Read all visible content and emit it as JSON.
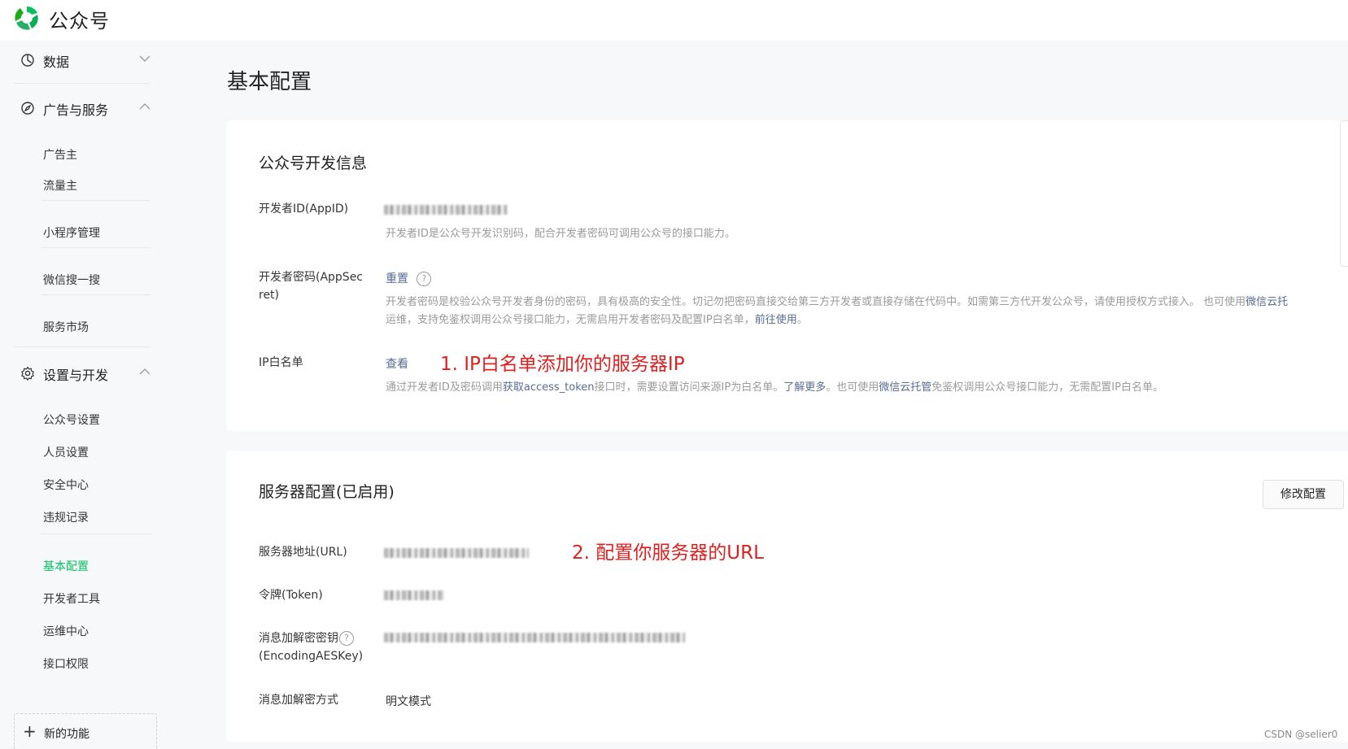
{
  "app": {
    "brand": "公众号"
  },
  "sidebar": {
    "groups": [
      {
        "label": "数据",
        "icon": "pie-chart-icon",
        "expanded": false
      },
      {
        "label": "广告与服务",
        "icon": "compass-icon",
        "expanded": true
      },
      {
        "label": "设置与开发",
        "icon": "gear-icon",
        "expanded": true
      }
    ],
    "items": {
      "ad_owner": "广告主",
      "traffic_owner": "流量主",
      "mini_program": "小程序管理",
      "wechat_search": "微信搜一搜",
      "service_market": "服务市场",
      "account_settings": "公众号设置",
      "staff_settings": "人员设置",
      "security_center": "安全中心",
      "violation_record": "违规记录",
      "basic_config": "基本配置",
      "dev_tools": "开发者工具",
      "ops_center": "运维中心",
      "api_permission": "接口权限"
    },
    "new_feature": "新的功能",
    "active_color": "#07c160"
  },
  "page": {
    "title": "基本配置"
  },
  "dev_info": {
    "title": "公众号开发信息",
    "appid_label": "开发者ID(AppID)",
    "appid_desc": "开发者ID是公众号开发识别码，配合开发者密码可调用公众号的接口能力。",
    "secret_label_1": "开发者密码(AppSec",
    "secret_label_2": "ret)",
    "secret_reset": "重置",
    "secret_desc_1": "开发者密码是校验公众号开发者身份的密码，具有极高的安全性。切记勿把密码直接交给第三方开发者或直接存储在代码中。如需第三方代开发公众号，请使用授权方式接入。 也可使用",
    "secret_desc_1_link": "微信云托",
    "secret_desc_2": "运维，支持免鉴权调用公众号接口能力，无需启用开发者密码及配置IP白名单，",
    "secret_desc_2_link": "前往使用",
    "secret_desc_2_end": "。",
    "ip_label": "IP白名单",
    "ip_view": "查看",
    "ip_desc_a": "通过开发者ID及密码调用",
    "ip_desc_link1": "获取access_token",
    "ip_desc_b": "接口时，需要设置访问来源IP为白名单。",
    "ip_desc_link2": "了解更多",
    "ip_desc_c": "。也可使用",
    "ip_desc_link3": "微信云托管",
    "ip_desc_d": "免鉴权调用公众号接口能力，无需配置IP白名单。"
  },
  "server_config": {
    "title": "服务器配置(已启用)",
    "edit_button": "修改配置",
    "url_label": "服务器地址(URL)",
    "token_label": "令牌(Token)",
    "aes_label_1": "消息加解密密钥",
    "aes_label_2": "(EncodingAESKey)",
    "mode_label": "消息加解密方式",
    "mode_value": "明文模式"
  },
  "annotations": {
    "step1": "1. IP白名单添加你的服务器IP",
    "step2": "2. 配置你服务器的URL"
  },
  "watermark": "CSDN @selier0",
  "colors": {
    "link": "#576b95",
    "annotation": "#e02020",
    "brand_green": "#07c160"
  }
}
